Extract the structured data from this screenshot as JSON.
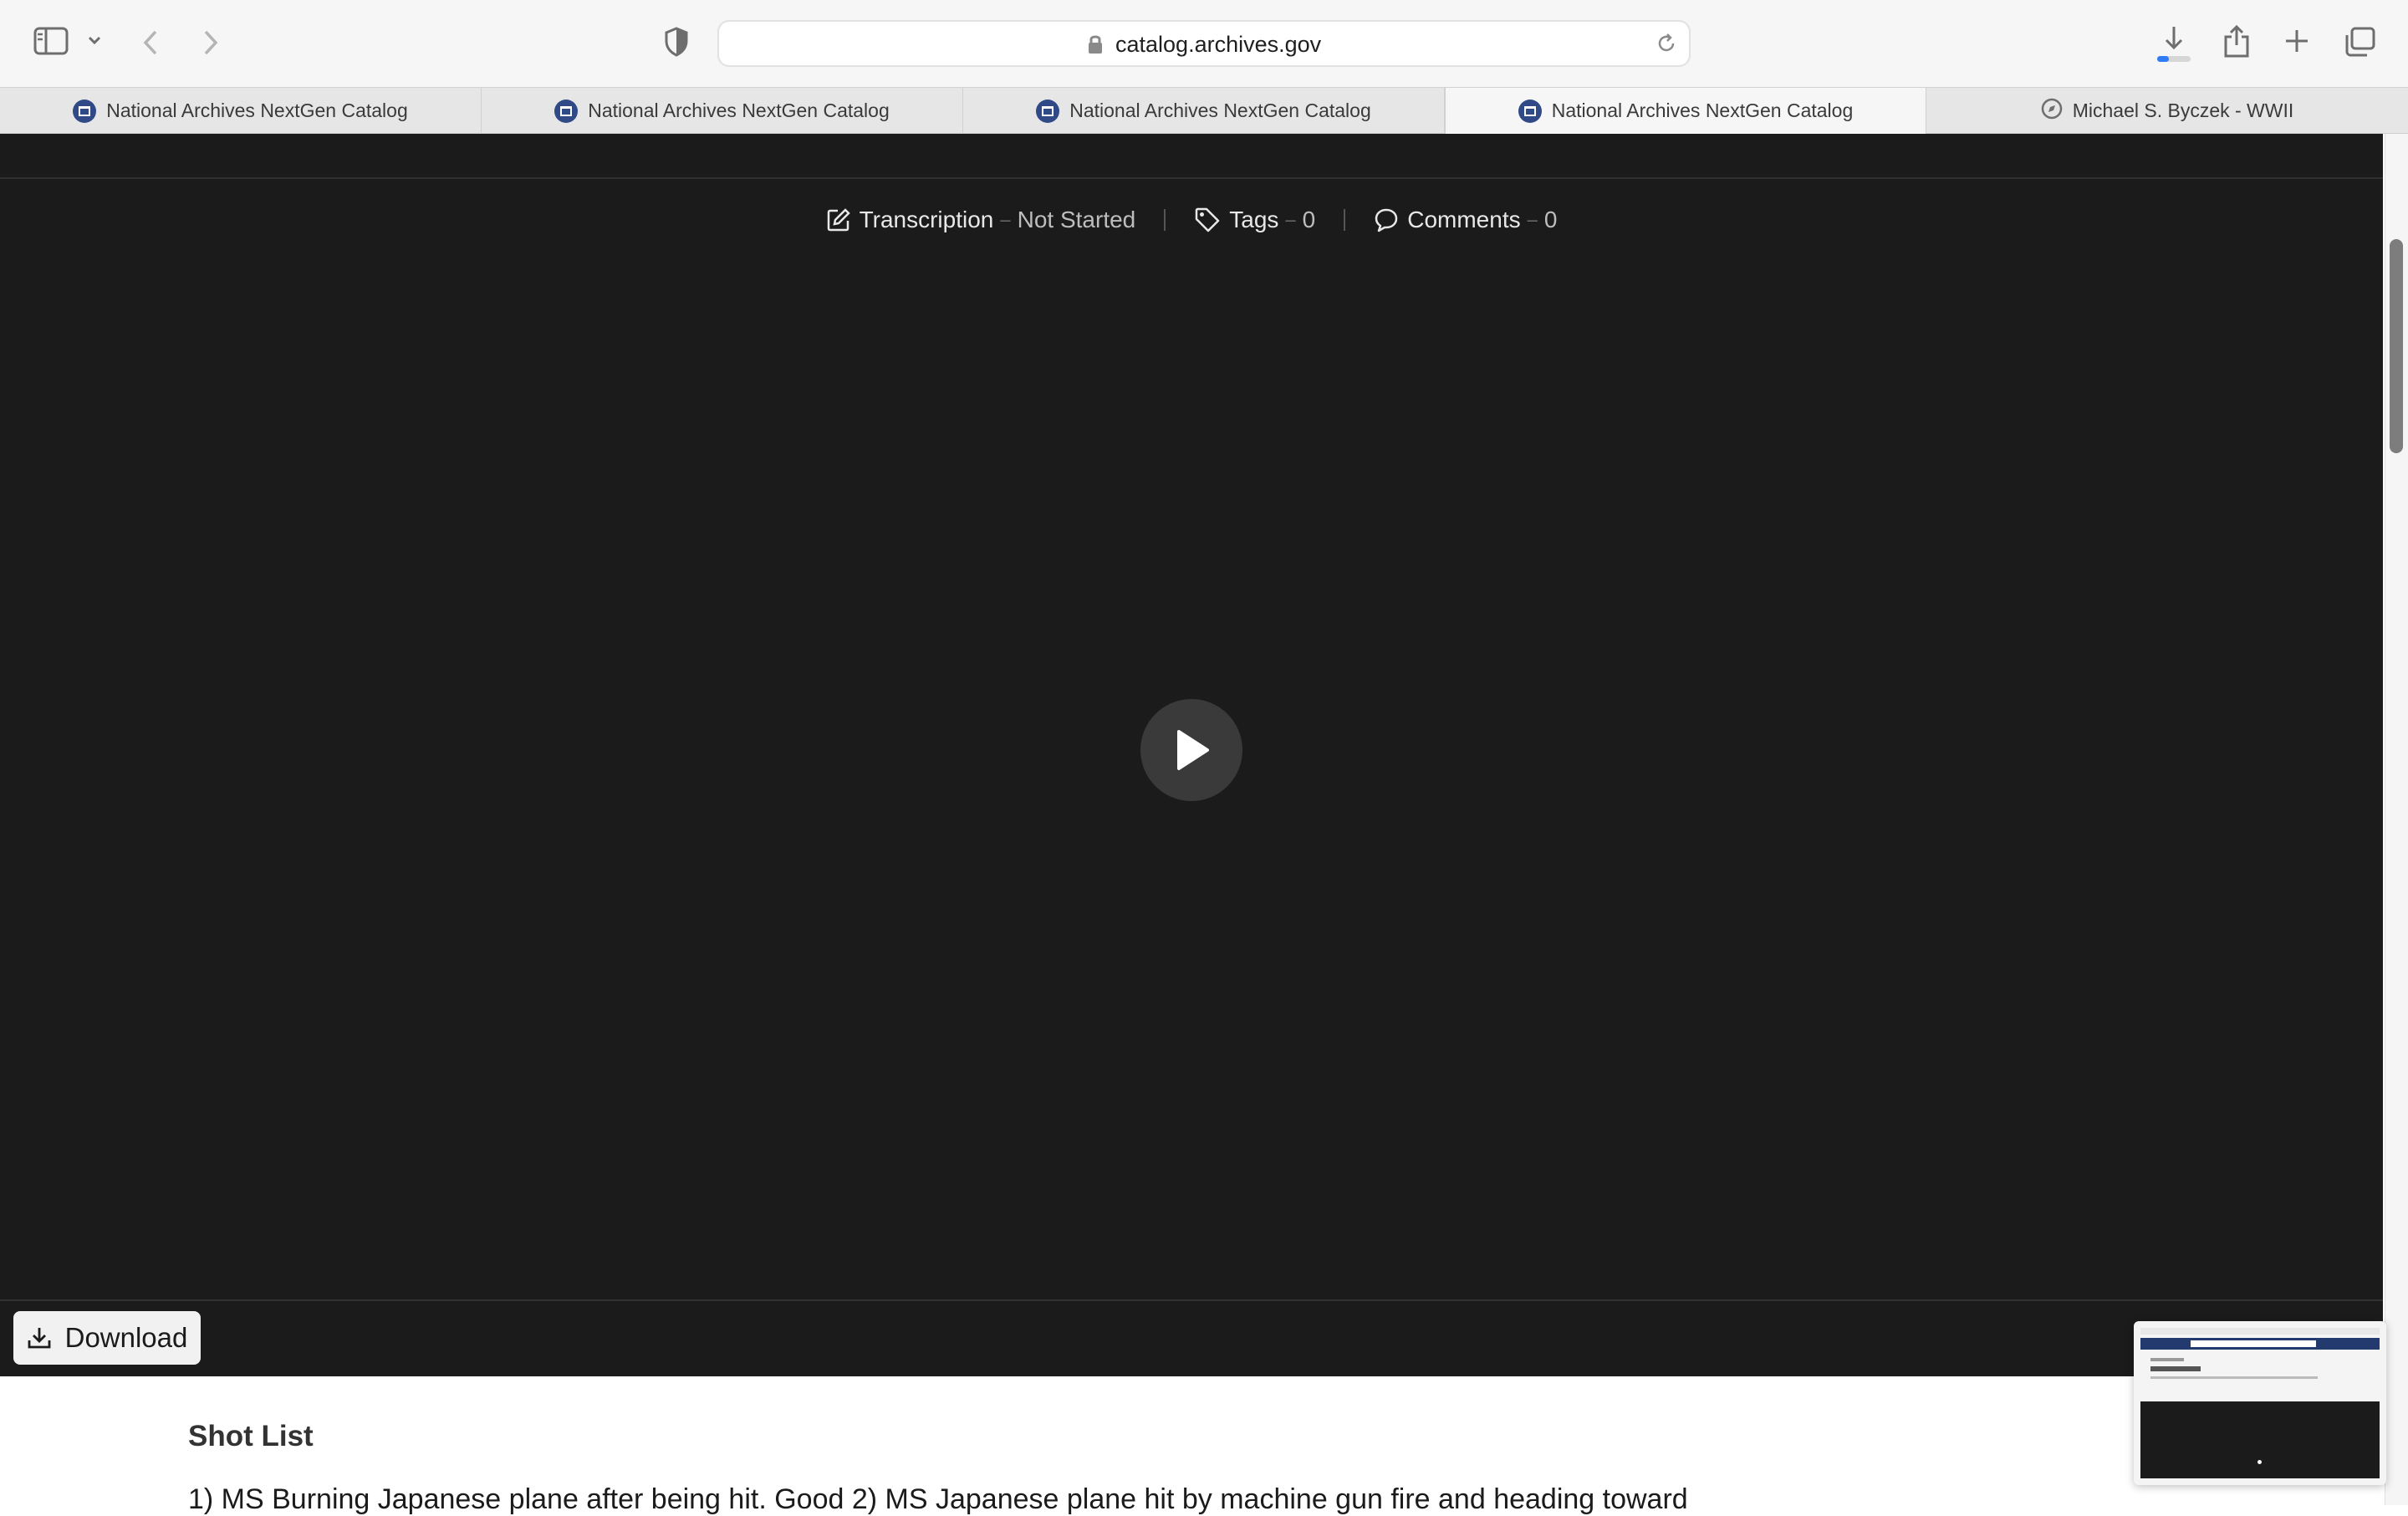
{
  "browser": {
    "url": "catalog.archives.gov",
    "tabs": [
      {
        "label": "National Archives NextGen Catalog",
        "active": false,
        "icon": "archives-favicon"
      },
      {
        "label": "National Archives NextGen Catalog",
        "active": false,
        "icon": "archives-favicon"
      },
      {
        "label": "National Archives NextGen Catalog",
        "active": false,
        "icon": "archives-favicon"
      },
      {
        "label": "National Archives NextGen Catalog",
        "active": true,
        "icon": "archives-favicon"
      },
      {
        "label": "Michael S. Byczek - WWII",
        "active": false,
        "icon": "compass-icon"
      }
    ],
    "download_progress": 0.35
  },
  "record": {
    "transcription_label": "Transcription",
    "transcription_value": "Not Started",
    "tags_label": "Tags",
    "tags_value": "0",
    "comments_label": "Comments",
    "comments_value": "0",
    "download_label": "Download"
  },
  "shot_list": {
    "title": "Shot List",
    "text": "1) MS Burning Japanese plane after being hit. Good 2) MS Japanese plane hit by machine gun fire and heading toward"
  },
  "colors": {
    "viewer_background": "#1b1b1b",
    "accent_navy": "#2f4a86"
  }
}
